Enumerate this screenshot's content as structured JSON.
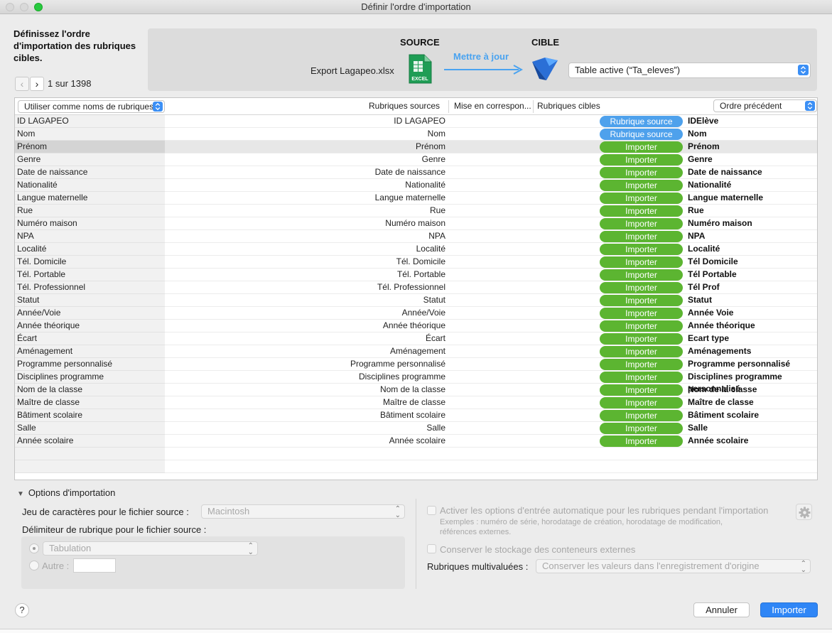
{
  "window": {
    "title": "Définir l'ordre d'importation"
  },
  "header": {
    "instruction": "Définissez l'ordre d'importation des rubriques cibles.",
    "pager_text": "1 sur 1398",
    "prev_glyph": "‹",
    "next_glyph": "›",
    "source_title": "SOURCE",
    "target_title": "CIBLE",
    "source_file": "Export Lagapeo.xlsx",
    "update_label": "Mettre à jour",
    "excel_label": "EXCEL",
    "target_table": "Table active (“Ta_eleves”)"
  },
  "table": {
    "use_names_select": "Utiliser comme noms de rubriques",
    "col_source": "Rubriques sources",
    "col_mapping": "Mise en correspon...",
    "col_target": "Rubriques cibles",
    "order_select": "Ordre précédent",
    "rows": [
      {
        "left": "ID LAGAPEO",
        "source": "ID LAGAPEO",
        "action": "Rubrique source",
        "target": "IDElève"
      },
      {
        "left": "Nom",
        "source": "Nom",
        "action": "Rubrique source",
        "target": "Nom"
      },
      {
        "left": "Prénom",
        "source": "Prénom",
        "action": "Importer",
        "target": "Prénom"
      },
      {
        "left": "Genre",
        "source": "Genre",
        "action": "Importer",
        "target": "Genre"
      },
      {
        "left": "Date de naissance",
        "source": "Date de naissance",
        "action": "Importer",
        "target": "Date de naissance"
      },
      {
        "left": "Nationalité",
        "source": "Nationalité",
        "action": "Importer",
        "target": "Nationalité"
      },
      {
        "left": "Langue maternelle",
        "source": "Langue maternelle",
        "action": "Importer",
        "target": "Langue maternelle"
      },
      {
        "left": "Rue",
        "source": "Rue",
        "action": "Importer",
        "target": "Rue"
      },
      {
        "left": "Numéro maison",
        "source": "Numéro maison",
        "action": "Importer",
        "target": "Numéro maison"
      },
      {
        "left": "NPA",
        "source": "NPA",
        "action": "Importer",
        "target": "NPA"
      },
      {
        "left": "Localité",
        "source": "Localité",
        "action": "Importer",
        "target": "Localité"
      },
      {
        "left": "Tél. Domicile",
        "source": "Tél. Domicile",
        "action": "Importer",
        "target": "Tél Domicile"
      },
      {
        "left": "Tél. Portable",
        "source": "Tél. Portable",
        "action": "Importer",
        "target": "Tél Portable"
      },
      {
        "left": "Tél. Professionnel",
        "source": "Tél. Professionnel",
        "action": "Importer",
        "target": "Tél Prof"
      },
      {
        "left": "Statut",
        "source": "Statut",
        "action": "Importer",
        "target": "Statut"
      },
      {
        "left": "Année/Voie",
        "source": "Année/Voie",
        "action": "Importer",
        "target": "Année Voie"
      },
      {
        "left": "Année théorique",
        "source": "Année théorique",
        "action": "Importer",
        "target": "Année théorique"
      },
      {
        "left": "Écart",
        "source": "Écart",
        "action": "Importer",
        "target": "Ecart type"
      },
      {
        "left": "Aménagement",
        "source": "Aménagement",
        "action": "Importer",
        "target": "Aménagements"
      },
      {
        "left": "Programme personnalisé",
        "source": "Programme personnalisé",
        "action": "Importer",
        "target": "Programme personnalisé"
      },
      {
        "left": "Disciplines programme",
        "source": "Disciplines programme",
        "action": "Importer",
        "target": "Disciplines programme personnalisé"
      },
      {
        "left": "Nom de la classe",
        "source": "Nom de la classe",
        "action": "Importer",
        "target": "Nom de la classe"
      },
      {
        "left": "Maître de classe",
        "source": "Maître de classe",
        "action": "Importer",
        "target": "Maître de classe"
      },
      {
        "left": "Bâtiment scolaire",
        "source": "Bâtiment scolaire",
        "action": "Importer",
        "target": "Bâtiment scolaire"
      },
      {
        "left": "Salle",
        "source": "Salle",
        "action": "Importer",
        "target": "Salle"
      },
      {
        "left": "Année scolaire",
        "source": "Année scolaire",
        "action": "Importer",
        "target": "Année scolaire"
      }
    ]
  },
  "options": {
    "toggle_label": "Options d'importation",
    "charset_label": "Jeu de caractères pour le fichier source :",
    "charset_value": "Macintosh",
    "delimiter_label": "Délimiteur de rubrique pour le fichier source :",
    "tab_value": "Tabulation",
    "other_label": "Autre :",
    "auto_entry_label": "Activer les options d'entrée automatique pour les rubriques pendant l'importation",
    "auto_entry_example_1": "Exemples : numéro de série, horodatage de création, horodatage de modification,",
    "auto_entry_example_2": "références externes.",
    "external_storage_label": "Conserver le stockage des conteneurs externes",
    "multivalued_label": "Rubriques multivaluées :",
    "multivalued_value": "Conserver les valeurs dans l'enregistrement d'origine"
  },
  "footer": {
    "help_label": "?",
    "cancel_label": "Annuler",
    "import_label": "Importer"
  },
  "colors": {
    "import_pill": "#5cb531",
    "source_pill": "#4ea1ec",
    "primary_button": "#2f86f6"
  }
}
